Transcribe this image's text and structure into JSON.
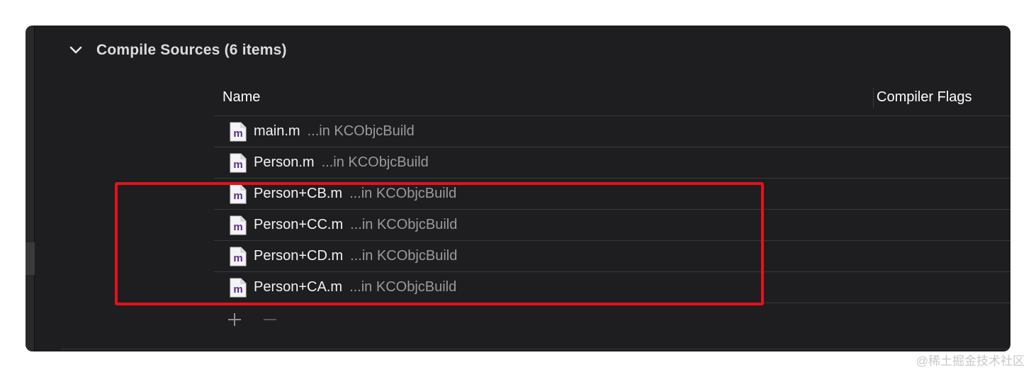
{
  "section": {
    "title": "Compile Sources (6 items)",
    "icon": "chevron-down-icon"
  },
  "table": {
    "columns": [
      "Name",
      "Compiler Flags"
    ],
    "rows": [
      {
        "name": "main.m",
        "path": "...in KCObjcBuild",
        "icon": "objc-file-icon",
        "icon_letter": "m"
      },
      {
        "name": "Person.m",
        "path": "...in KCObjcBuild",
        "icon": "objc-file-icon",
        "icon_letter": "m"
      },
      {
        "name": "Person+CB.m",
        "path": "...in KCObjcBuild",
        "icon": "objc-file-icon",
        "icon_letter": "m"
      },
      {
        "name": "Person+CC.m",
        "path": "...in KCObjcBuild",
        "icon": "objc-file-icon",
        "icon_letter": "m"
      },
      {
        "name": "Person+CD.m",
        "path": "...in KCObjcBuild",
        "icon": "objc-file-icon",
        "icon_letter": "m"
      },
      {
        "name": "Person+CA.m",
        "path": "...in KCObjcBuild",
        "icon": "objc-file-icon",
        "icon_letter": "m"
      }
    ]
  },
  "toolbar": {
    "add_icon": "plus-icon",
    "remove_icon": "minus-icon"
  },
  "annotation": {
    "highlight_color": "#e8101a"
  },
  "watermark": "@稀土掘金技术社区",
  "colors": {
    "background": "#1e1e21",
    "text": "#f2f2f4",
    "secondary_text": "#9a9a9f",
    "icon_accent": "#5b2d8e"
  }
}
